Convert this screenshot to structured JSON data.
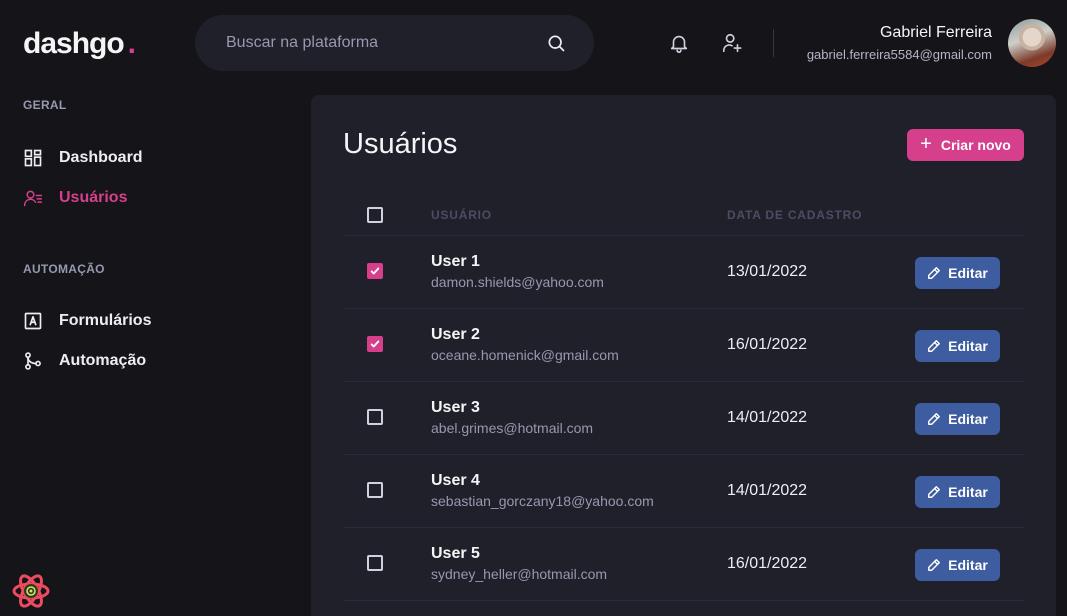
{
  "header": {
    "logo_text": "dashgo",
    "logo_dot": ".",
    "search_placeholder": "Buscar na plataforma",
    "user_name": "Gabriel Ferreira",
    "user_email": "gabriel.ferreira5584@gmail.com"
  },
  "sidebar": {
    "sections": [
      {
        "title": "GERAL",
        "items": [
          {
            "label": "Dashboard",
            "icon": "dashboard-icon"
          },
          {
            "label": "Usuários",
            "icon": "users-icon",
            "active": true
          }
        ]
      },
      {
        "title": "AUTOMAÇÃO",
        "items": [
          {
            "label": "Formulários",
            "icon": "form-icon"
          },
          {
            "label": "Automação",
            "icon": "git-merge-icon"
          }
        ]
      }
    ]
  },
  "main": {
    "title": "Usuários",
    "create_button": "Criar novo",
    "columns": [
      "USUÁRIO",
      "DATA DE CADASTRO"
    ],
    "edit_label": "Editar",
    "rows": [
      {
        "name": "User 1",
        "email": "damon.shields@yahoo.com",
        "date": "13/01/2022",
        "checked": true
      },
      {
        "name": "User 2",
        "email": "oceane.homenick@gmail.com",
        "date": "16/01/2022",
        "checked": true
      },
      {
        "name": "User 3",
        "email": "abel.grimes@hotmail.com",
        "date": "14/01/2022",
        "checked": false
      },
      {
        "name": "User 4",
        "email": "sebastian_gorczany18@yahoo.com",
        "date": "14/01/2022",
        "checked": false
      },
      {
        "name": "User 5",
        "email": "sydney_heller@hotmail.com",
        "date": "16/01/2022",
        "checked": false
      }
    ]
  },
  "colors": {
    "accent": "#d53f8c",
    "edit_button": "#3d5da0",
    "background": "#141419",
    "panel": "#1f2029"
  }
}
